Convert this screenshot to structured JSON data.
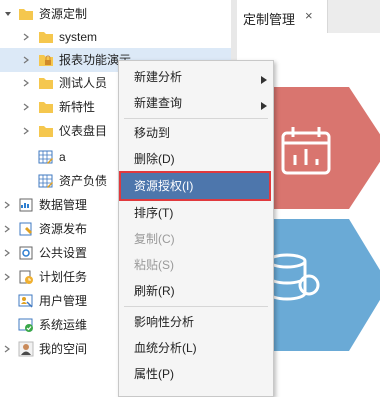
{
  "tree": {
    "items": [
      {
        "label": "资源定制",
        "icon": "folder-icon"
      },
      {
        "label": "system",
        "icon": "folder-icon"
      },
      {
        "label": "报表功能演示",
        "icon": "locked-folder-icon"
      },
      {
        "label": "测试人员",
        "icon": "folder-icon"
      },
      {
        "label": "新特性",
        "icon": "folder-icon"
      },
      {
        "label": "仪表盘目",
        "icon": "folder-icon"
      },
      {
        "label": "a",
        "icon": "report-icon"
      },
      {
        "label": "资产负债",
        "icon": "report-icon"
      },
      {
        "label": "数据管理",
        "icon": "data-manage-icon"
      },
      {
        "label": "资源发布",
        "icon": "publish-icon"
      },
      {
        "label": "公共设置",
        "icon": "settings-icon"
      },
      {
        "label": "计划任务",
        "icon": "schedule-icon"
      },
      {
        "label": "用户管理",
        "icon": "user-manage-icon"
      },
      {
        "label": "系统运维",
        "icon": "maintenance-icon"
      },
      {
        "label": "我的空间",
        "icon": "my-space-icon"
      }
    ]
  },
  "tabs": [
    {
      "label": "定制管理",
      "close": "×"
    }
  ],
  "context_menu": {
    "items": [
      {
        "label": "新建分析",
        "has_submenu": true,
        "disabled": false
      },
      {
        "label": "新建查询",
        "has_submenu": true,
        "disabled": false
      },
      {
        "label": "移动到",
        "has_submenu": false,
        "disabled": false
      },
      {
        "label": "删除(D)",
        "has_submenu": false,
        "disabled": false
      },
      {
        "label": "资源授权(I)",
        "has_submenu": false,
        "disabled": false,
        "highlighted": true
      },
      {
        "label": "排序(T)",
        "has_submenu": false,
        "disabled": false
      },
      {
        "label": "复制(C)",
        "has_submenu": false,
        "disabled": true
      },
      {
        "label": "粘贴(S)",
        "has_submenu": false,
        "disabled": true
      },
      {
        "label": "刷新(R)",
        "has_submenu": false,
        "disabled": false
      },
      {
        "label": "影响性分析",
        "has_submenu": false,
        "disabled": false
      },
      {
        "label": "血统分析(L)",
        "has_submenu": false,
        "disabled": false
      },
      {
        "label": "属性(P)",
        "has_submenu": false,
        "disabled": false
      }
    ]
  },
  "colors": {
    "highlight_bg": "#4d76ac",
    "highlight_border": "#e0393d",
    "hex_red": "#d9756f",
    "hex_blue": "#6aaad6",
    "folder": "#f5c74e"
  }
}
